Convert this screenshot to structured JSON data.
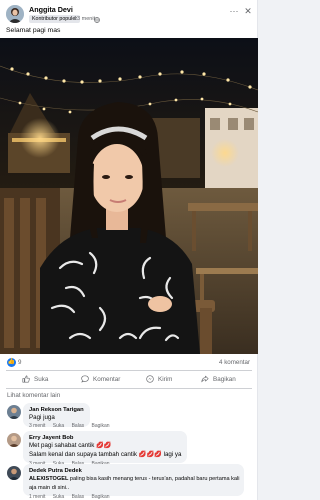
{
  "post": {
    "author": "Anggita Devi",
    "badge": "Kontributor populer",
    "time": "13 menit",
    "dot": "·",
    "more_icon": "···",
    "close_icon": "✕",
    "caption": "Selamat pagi mas"
  },
  "reactions": {
    "like_icon": "👍",
    "count": "9",
    "comments": "4 komentar"
  },
  "actions": {
    "like": "Suka",
    "comment": "Komentar",
    "send": "Kirim",
    "share": "Bagikan"
  },
  "more_comments": "Lihat komentar lain",
  "comments": [
    {
      "name": "Jan Rekson Tarigan",
      "text": "Pagi juga",
      "time": "3 menit",
      "like": "Suka",
      "reply": "Balas",
      "share": "Bagikan"
    },
    {
      "name": "Erry Jayent Bob",
      "line1": "Met pagi sahabat cantik ",
      "hearts1": "💋💋",
      "line2": "Salam kenal dan supaya tambah cantik ",
      "hearts2": "💋💋💋",
      "line2_end": " lagi ya",
      "time": "3 menit",
      "like": "Suka",
      "reply": "Balas",
      "share": "Bagikan"
    },
    {
      "name": "Dedek Putra Dedek",
      "bold": "ALEXISTOGEL",
      "text_rest": " paling bisa kasih menang terus - terus'an, padahal baru pertama kali",
      "line2": "aja main di sini..",
      "time": "1 menit",
      "like": "Suka",
      "reply": "Balas",
      "share": "Bagikan"
    }
  ],
  "colors": {
    "accent": "#1877f2",
    "text": "#050505",
    "secondary": "#65676b",
    "bubble": "#f0f2f5"
  }
}
